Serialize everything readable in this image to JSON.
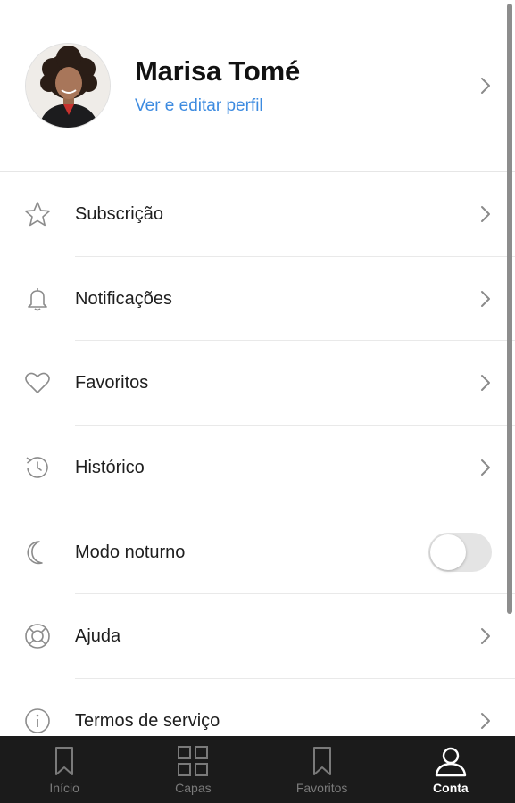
{
  "profile": {
    "name": "Marisa Tomé",
    "link": "Ver e editar perfil",
    "avatar_icon": "user-photo"
  },
  "menu": {
    "items": [
      {
        "label": "Subscrição",
        "icon": "star-icon",
        "control": "chevron"
      },
      {
        "label": "Notificações",
        "icon": "bell-icon",
        "control": "chevron"
      },
      {
        "label": "Favoritos",
        "icon": "heart-icon",
        "control": "chevron"
      },
      {
        "label": "Histórico",
        "icon": "history-icon",
        "control": "chevron"
      },
      {
        "label": "Modo noturno",
        "icon": "moon-icon",
        "control": "toggle",
        "enabled": false
      },
      {
        "label": "Ajuda",
        "icon": "lifebuoy-icon",
        "control": "chevron"
      },
      {
        "label": "Termos de serviço",
        "icon": "info-icon",
        "control": "chevron"
      }
    ]
  },
  "bottom_nav": {
    "items": [
      {
        "label": "Início",
        "icon": "bookmark-icon",
        "active": false
      },
      {
        "label": "Capas",
        "icon": "grid-icon",
        "active": false
      },
      {
        "label": "Favoritos",
        "icon": "bookmark-icon",
        "active": false
      },
      {
        "label": "Conta",
        "icon": "user-icon",
        "active": true
      }
    ]
  },
  "colors": {
    "link": "#3d8be0",
    "nav_background": "#1b1b1b",
    "nav_inactive": "#7a7a7a",
    "nav_active": "#ffffff",
    "toggle_off": "#e4e4e4"
  }
}
